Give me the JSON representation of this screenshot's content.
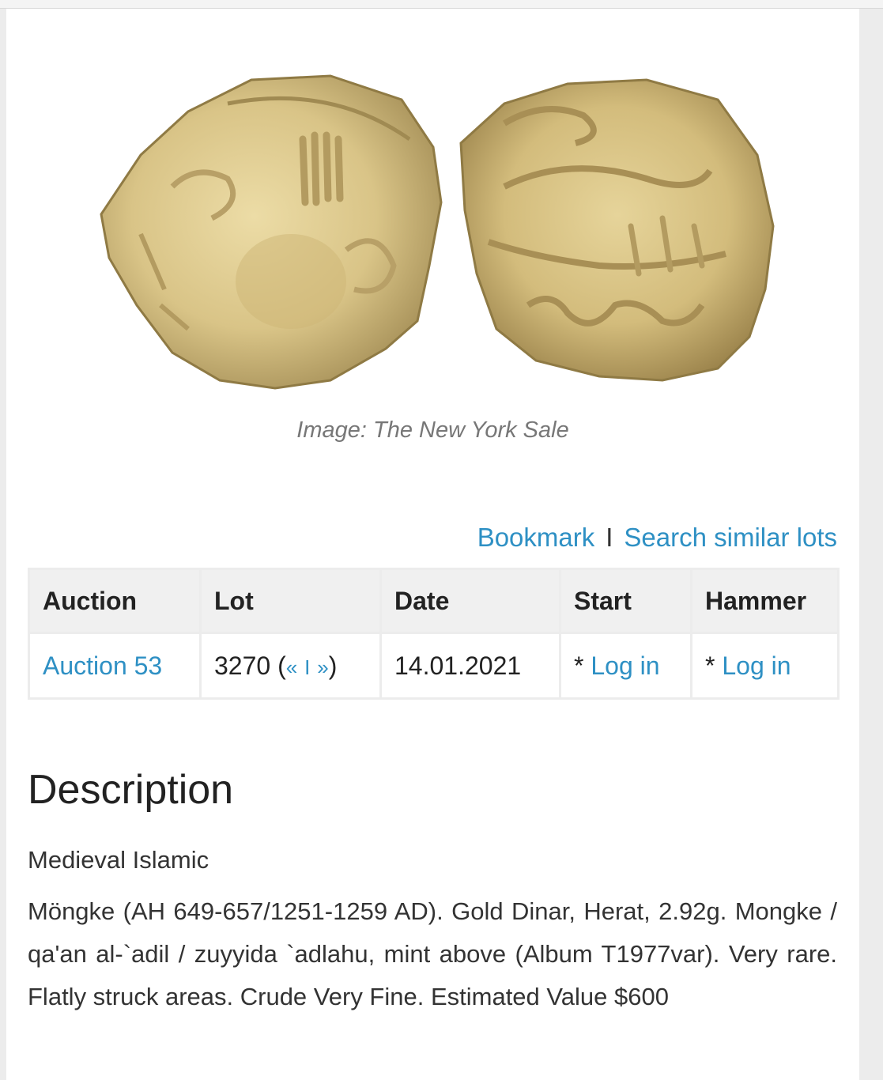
{
  "image": {
    "caption": "Image: The New York Sale",
    "coin_color": "#d9c487"
  },
  "actions": {
    "bookmark": "Bookmark",
    "separator": "I",
    "search_similar": "Search similar lots"
  },
  "table": {
    "headers": [
      "Auction",
      "Lot",
      "Date",
      "Start",
      "Hammer"
    ],
    "row": {
      "auction": "Auction 53",
      "lot_number": "3270",
      "lot_nav_open": "(",
      "lot_prev": "«",
      "lot_nav_sep": "I",
      "lot_next": "»",
      "lot_nav_close": ")",
      "date": "14.01.2021",
      "start_prefix": "*",
      "start_link": "Log in",
      "hammer_prefix": "*",
      "hammer_link": "Log in"
    }
  },
  "description": {
    "title": "Description",
    "category": "Medieval Islamic",
    "text": "Möngke (AH 649-657/1251-1259 AD). Gold Dinar, Herat, 2.92g. Mongke / qa'an al-`adil / zuyyida `adlahu, mint above (Album T1977var). Very rare. Flatly struck areas. Crude Very Fine. Estimated Value $600"
  },
  "colors": {
    "link": "#2e90c4",
    "header_bg": "#f0f0f0",
    "border": "#ececec"
  }
}
